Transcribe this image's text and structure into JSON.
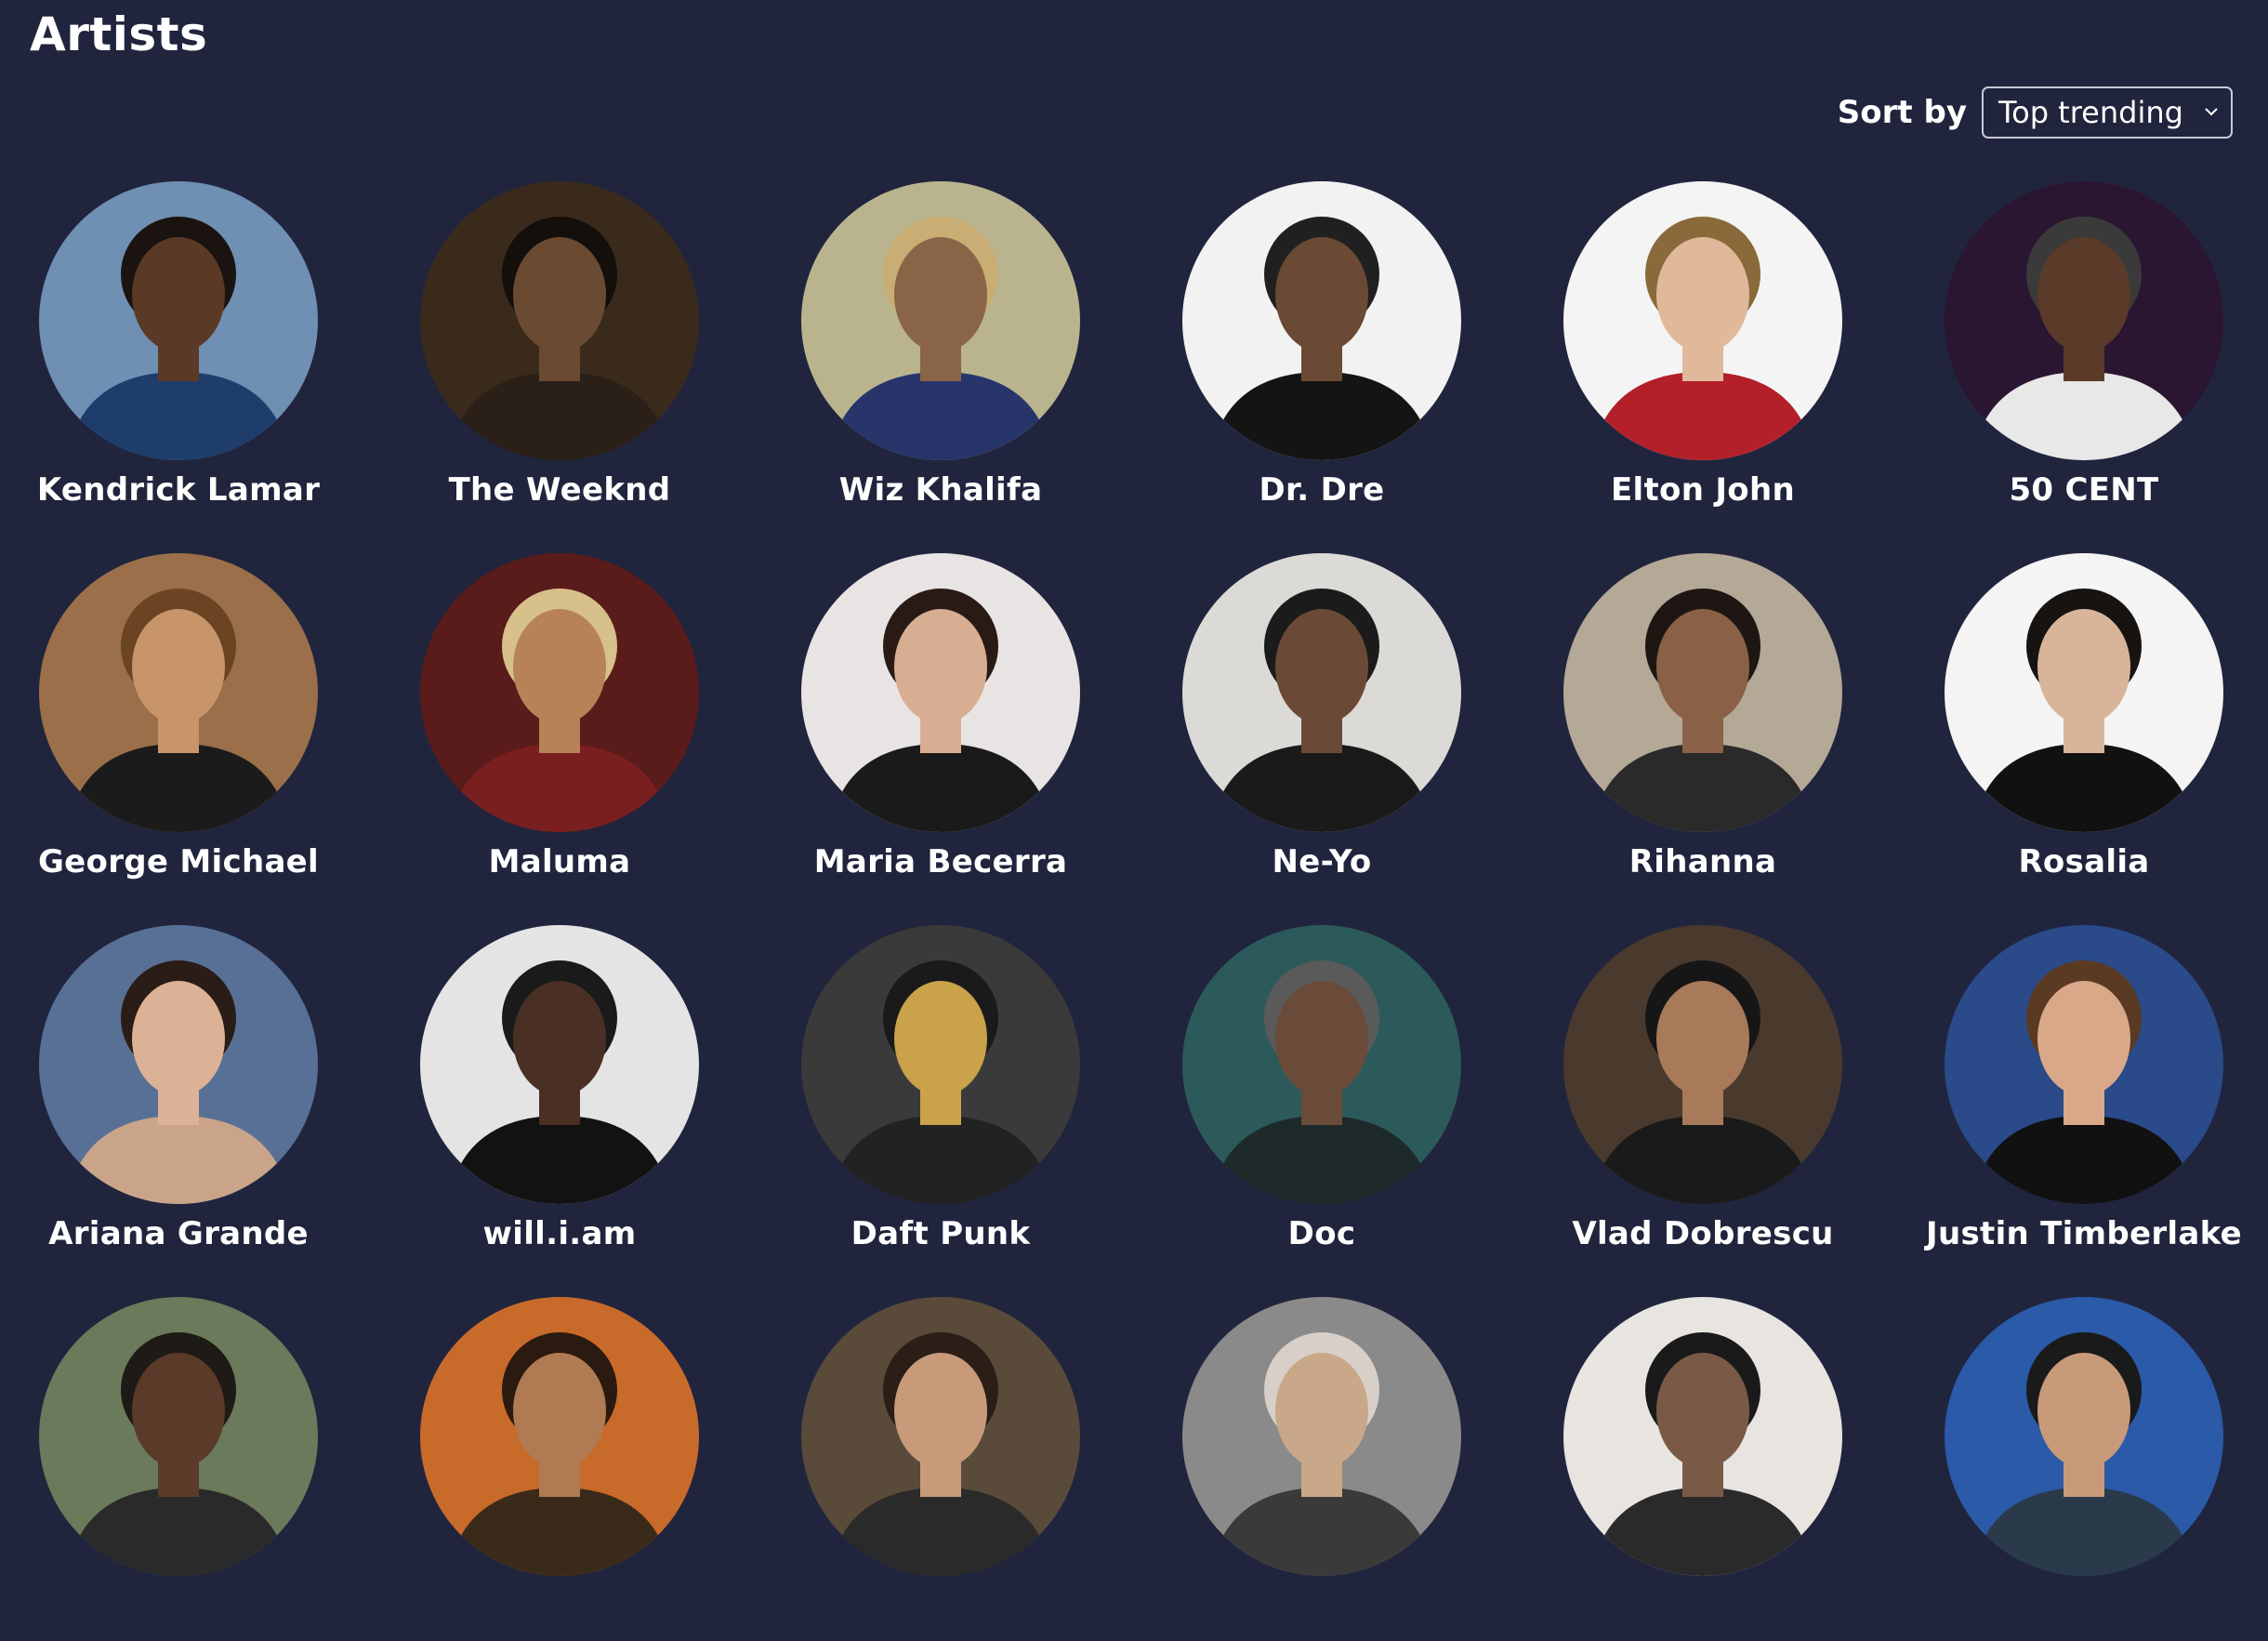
{
  "header": {
    "title": "Artists"
  },
  "sort": {
    "label": "Sort by",
    "selected": "Top trending",
    "icon": "chevron-down-icon"
  },
  "artists": [
    {
      "name": "Kendrick Lamar",
      "bg": "#6f8fb3",
      "skin": "#5a3a26",
      "hair": "#1a1310",
      "shirt": "#1f3d6b"
    },
    {
      "name": "The Weeknd",
      "bg": "#3a2a1c",
      "skin": "#6b4a32",
      "hair": "#140f0b",
      "shirt": "#2a2018"
    },
    {
      "name": "Wiz Khalifa",
      "bg": "#b9b48e",
      "skin": "#8a6446",
      "hair": "#c8ad74",
      "shirt": "#27356b"
    },
    {
      "name": "Dr. Dre",
      "bg": "#f2f2f2",
      "skin": "#6a4a35",
      "hair": "#202020",
      "shirt": "#141414"
    },
    {
      "name": "Elton John",
      "bg": "#f4f4f4",
      "skin": "#e0b89a",
      "hair": "#8a6a3a",
      "shirt": "#b3202a"
    },
    {
      "name": "50 CENT",
      "bg": "#2a1630",
      "skin": "#5a3a28",
      "hair": "#3a3a3a",
      "shirt": "#e8e8e8"
    },
    {
      "name": "George Michael",
      "bg": "#9a6f4a",
      "skin": "#c8946a",
      "hair": "#6a4423",
      "shirt": "#1b1b1b"
    },
    {
      "name": "Maluma",
      "bg": "#5a1b1b",
      "skin": "#b78258",
      "hair": "#d8c08a",
      "shirt": "#7a1f1f"
    },
    {
      "name": "Maria Becerra",
      "bg": "#e8e4e4",
      "skin": "#d8ae92",
      "hair": "#2a1a16",
      "shirt": "#1a1a1a"
    },
    {
      "name": "Ne-Yo",
      "bg": "#dcdad6",
      "skin": "#6a4a36",
      "hair": "#1b1b1b",
      "shirt": "#1a1a1a"
    },
    {
      "name": "Rihanna",
      "bg": "#b4a896",
      "skin": "#8a6046",
      "hair": "#1e1612",
      "shirt": "#2a2a2a"
    },
    {
      "name": "Rosalia",
      "bg": "#f4f4f4",
      "skin": "#d8b49a",
      "hair": "#171310",
      "shirt": "#111111"
    },
    {
      "name": "Ariana Grande",
      "bg": "#587096",
      "skin": "#dcb296",
      "hair": "#2a1c16",
      "shirt": "#c9a488"
    },
    {
      "name": "will.i.am",
      "bg": "#e4e4e4",
      "skin": "#4a3024",
      "hair": "#1a1a1a",
      "shirt": "#121212"
    },
    {
      "name": "Daft Punk",
      "bg": "#3a3a3a",
      "skin": "#c9a24a",
      "hair": "#1a1a1a",
      "shirt": "#222222"
    },
    {
      "name": "Doc",
      "bg": "#2c5a5a",
      "skin": "#6a4a38",
      "hair": "#5a5a5a",
      "shirt": "#1e2a2a"
    },
    {
      "name": "Vlad Dobrescu",
      "bg": "#4a3a2e",
      "skin": "#a87a5a",
      "hair": "#161616",
      "shirt": "#1a1a1a"
    },
    {
      "name": "Justin Timberlake",
      "bg": "#2a4a8a",
      "skin": "#d8a888",
      "hair": "#5a3a22",
      "shirt": "#111111"
    },
    {
      "name": "",
      "bg": "#6a7a5a",
      "skin": "#5a3a28",
      "hair": "#1e1a16",
      "shirt": "#2a2a2a"
    },
    {
      "name": "",
      "bg": "#c86a2a",
      "skin": "#b07a52",
      "hair": "#2a1a10",
      "shirt": "#3a2a1a"
    },
    {
      "name": "",
      "bg": "#5a4a3a",
      "skin": "#c89a7a",
      "hair": "#2a1e16",
      "shirt": "#2a2a2a"
    },
    {
      "name": "",
      "bg": "#8a8a8a",
      "skin": "#c8a888",
      "hair": "#d8d0c8",
      "shirt": "#3a3a3a"
    },
    {
      "name": "",
      "bg": "#e8e4e0",
      "skin": "#7a5a46",
      "hair": "#1a1a1a",
      "shirt": "#2a2a2a"
    },
    {
      "name": "",
      "bg": "#2a5aa8",
      "skin": "#c89a7a",
      "hair": "#1a1a1a",
      "shirt": "#2a3a4a"
    }
  ]
}
